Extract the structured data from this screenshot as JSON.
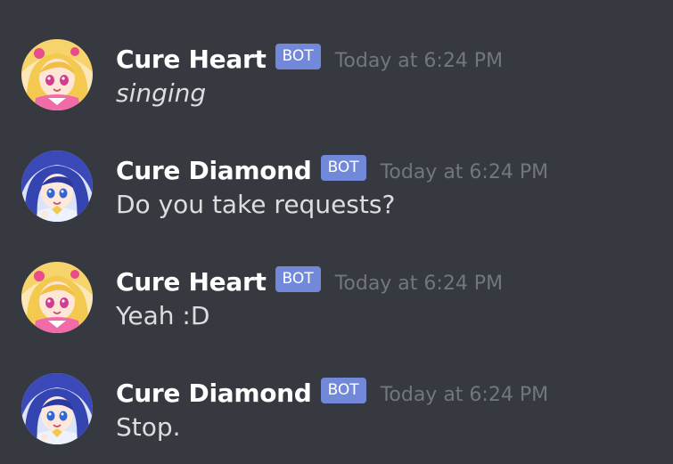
{
  "messages": [
    {
      "avatar_icon": "cure-heart-avatar-icon",
      "username": "Cure Heart",
      "tag": "BOT",
      "timestamp": "Today at 6:24 PM",
      "content": "singing",
      "italic": true
    },
    {
      "avatar_icon": "cure-diamond-avatar-icon",
      "username": "Cure Diamond",
      "tag": "BOT",
      "timestamp": "Today at 6:24 PM",
      "content": "Do you take requests?",
      "italic": false
    },
    {
      "avatar_icon": "cure-heart-avatar-icon",
      "username": "Cure Heart",
      "tag": "BOT",
      "timestamp": "Today at 6:24 PM",
      "content": "Yeah :D",
      "italic": false
    },
    {
      "avatar_icon": "cure-diamond-avatar-icon",
      "username": "Cure Diamond",
      "tag": "BOT",
      "timestamp": "Today at 6:24 PM",
      "content": "Stop.",
      "italic": false
    }
  ],
  "colors": {
    "background": "#36393f",
    "username": "#ffffff",
    "bot_tag": "#7289da",
    "timestamp": "#72767d",
    "message_text": "#dcddde"
  }
}
